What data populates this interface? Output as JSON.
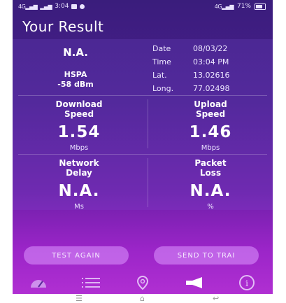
{
  "status_bar": {
    "signal": "4G",
    "signal2": "Voll",
    "time": "3:04",
    "network_info": "4G",
    "battery": "71%"
  },
  "title": "Your Result",
  "network": {
    "status": "N.A.",
    "type": "HSPA",
    "strength": "-58 dBm"
  },
  "info": [
    {
      "key": "Date",
      "value": "08/03/22"
    },
    {
      "key": "Time",
      "value": "03:04 PM"
    },
    {
      "key": "Lat.",
      "value": "13.02616"
    },
    {
      "key": "Long.",
      "value": "77.02498"
    }
  ],
  "metrics": [
    {
      "title1": "Download",
      "title2": "Speed",
      "value": "1.54",
      "unit": "Mbps"
    },
    {
      "title1": "Upload",
      "title2": "Speed",
      "value": "1.46",
      "unit": "Mbps"
    },
    {
      "title1": "Network",
      "title2": "Delay",
      "value": "N.A.",
      "unit": "Ms"
    },
    {
      "title1": "Packet",
      "title2": "Loss",
      "value": "N.A.",
      "unit": "%"
    }
  ],
  "buttons": {
    "test_again": "TEST AGAIN",
    "send_to_trai": "SEND TO TRAI"
  },
  "nav": {
    "icons": [
      "speedometer-icon",
      "list-icon",
      "location-pin-icon",
      "megaphone-icon",
      "info-icon"
    ]
  },
  "system_nav": {
    "icons": [
      "menu-icon",
      "home-icon",
      "back-icon"
    ]
  },
  "colors": {
    "top": "#3a1d7c",
    "bottom": "#b02fd2",
    "button": "#dc96ff"
  }
}
